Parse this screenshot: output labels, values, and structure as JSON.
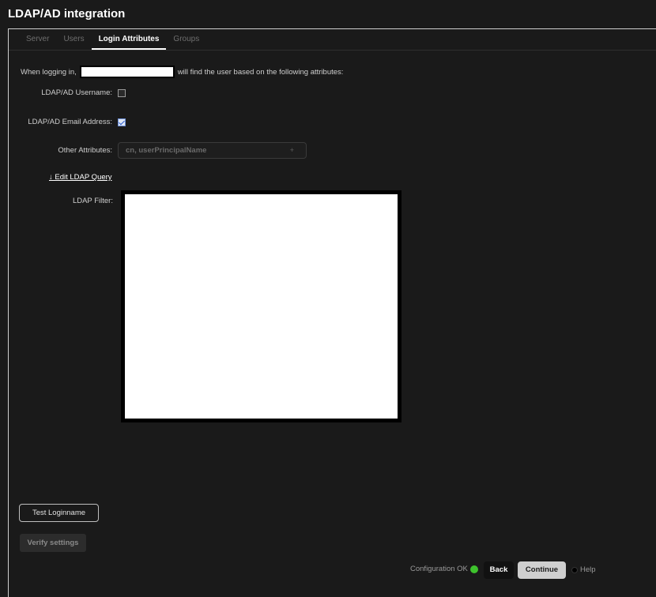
{
  "window": {
    "title": "LDAP/AD integration"
  },
  "tabs": [
    {
      "label": "Server",
      "active": false
    },
    {
      "label": "Users",
      "active": false
    },
    {
      "label": "Login Attributes",
      "active": true
    },
    {
      "label": "Groups",
      "active": false
    }
  ],
  "intro": {
    "prefix": "When logging in,",
    "suffix": "will find the user based on the following attributes:"
  },
  "fields": {
    "username_label": "LDAP/AD Username:",
    "username_checked": false,
    "email_label": "LDAP/AD Email Address:",
    "email_checked": true,
    "other_label": "Other Attributes:",
    "other_value": "cn, userPrincipalName",
    "other_add_icon": "+"
  },
  "edit_query": {
    "label": "↓ Edit LDAP Query"
  },
  "filter": {
    "label": "LDAP Filter:"
  },
  "buttons": {
    "test_loginname": "Test Loginname",
    "verify_settings": "Verify settings",
    "back": "Back",
    "continue": "Continue"
  },
  "footer": {
    "status_text": "Configuration OK",
    "status_color": "#3ec22d",
    "help": "Help"
  }
}
